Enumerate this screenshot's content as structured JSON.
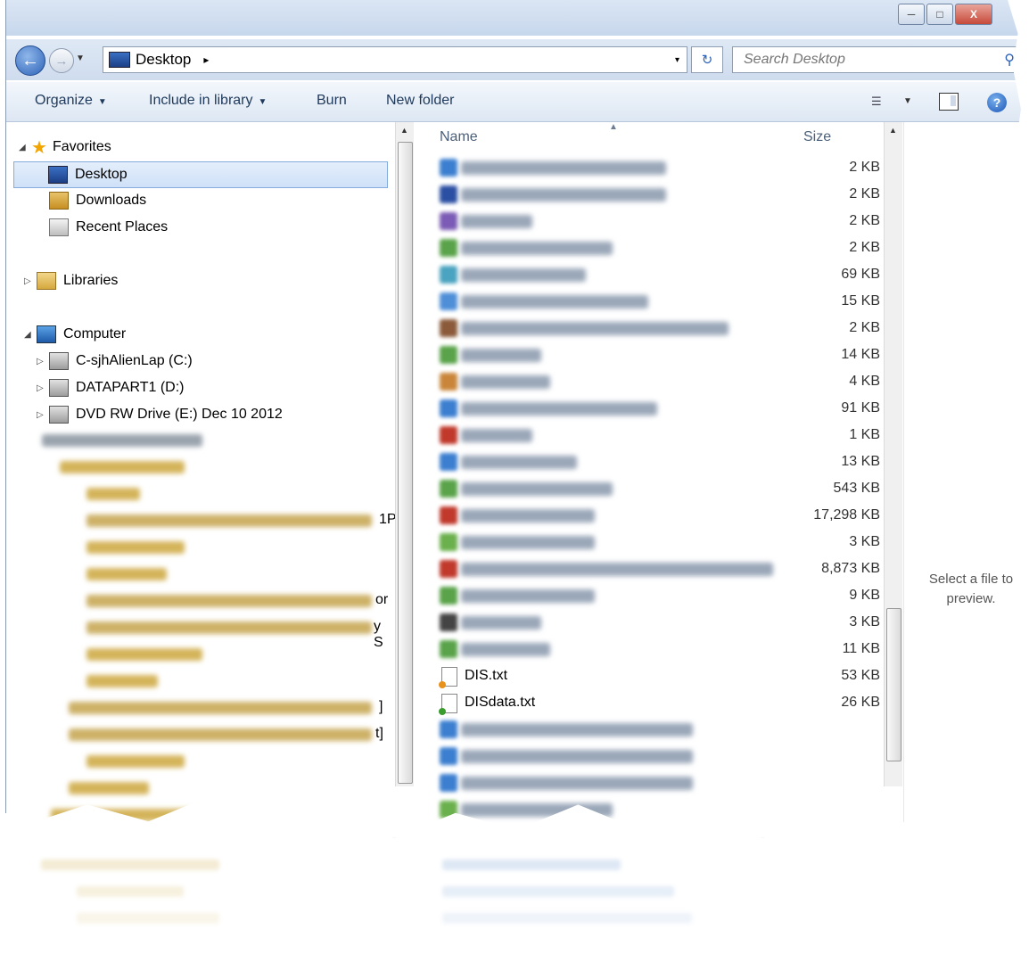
{
  "titlebar": {
    "minimize": "─",
    "maximize": "□",
    "close": "X"
  },
  "address": {
    "location": "Desktop",
    "chevron": "▸",
    "dropdown": "▾",
    "refresh": "↻"
  },
  "search": {
    "placeholder": "Search Desktop",
    "icon": "search-icon"
  },
  "toolbar": {
    "organize": "Organize",
    "include_in_library": "Include in library",
    "burn": "Burn",
    "new_folder": "New folder",
    "dropdown_glyph": "▼"
  },
  "navigation": {
    "favorites": "Favorites",
    "desktop": "Desktop",
    "downloads": "Downloads",
    "recent_places": "Recent Places",
    "libraries": "Libraries",
    "computer": "Computer",
    "drive_c": "C-sjhAlienLap (C:)",
    "drive_d": "DATAPART1 (D:)",
    "drive_e": "DVD RW Drive (E:) Dec 10 2012",
    "partial_text": [
      "1P",
      "or",
      "y S",
      "]",
      "t]"
    ]
  },
  "file_list": {
    "headers": {
      "name": "Name",
      "size": "Size"
    },
    "rows": [
      {
        "name": "",
        "size": "2 KB",
        "icon_color": "#3c7fd0"
      },
      {
        "name": "",
        "size": "2 KB",
        "icon_color": "#2b4fa3"
      },
      {
        "name": "",
        "size": "2 KB",
        "icon_color": "#7b5bb5"
      },
      {
        "name": "",
        "size": "2 KB",
        "icon_color": "#5aa34a"
      },
      {
        "name": "",
        "size": "69 KB",
        "icon_color": "#4aa3c0"
      },
      {
        "name": "",
        "size": "15 KB",
        "icon_color": "#4f8fd8"
      },
      {
        "name": "",
        "size": "2 KB",
        "icon_color": "#8a5a3a"
      },
      {
        "name": "",
        "size": "14 KB",
        "icon_color": "#5aa34a"
      },
      {
        "name": "",
        "size": "4 KB",
        "icon_color": "#c9863a"
      },
      {
        "name": "",
        "size": "91 KB",
        "icon_color": "#3c7fd0"
      },
      {
        "name": "",
        "size": "1 KB",
        "icon_color": "#c0392b"
      },
      {
        "name": "",
        "size": "13 KB",
        "icon_color": "#3c7fd0"
      },
      {
        "name": "",
        "size": "543 KB",
        "icon_color": "#5aa34a"
      },
      {
        "name": "",
        "size": "17,298 KB",
        "icon_color": "#c0392b"
      },
      {
        "name": "",
        "size": "3 KB",
        "icon_color": "#6ab04c"
      },
      {
        "name": "",
        "size": "8,873 KB",
        "icon_color": "#c0392b"
      },
      {
        "name": "",
        "size": "9 KB",
        "icon_color": "#5aa34a"
      },
      {
        "name": "",
        "size": "3 KB",
        "icon_color": "#444444"
      },
      {
        "name": "",
        "size": "11 KB",
        "icon_color": "#5aa34a"
      },
      {
        "name": "DIS.txt",
        "size": "53 KB",
        "icon_color": "#e8921d"
      },
      {
        "name": "DISdata.txt",
        "size": "26 KB",
        "icon_color": "#3a9c2c"
      },
      {
        "name": "",
        "size": "",
        "icon_color": "#3c7fd0"
      },
      {
        "name": "",
        "size": "",
        "icon_color": "#3c7fd0"
      },
      {
        "name": "",
        "size": "",
        "icon_color": "#3c7fd0"
      },
      {
        "name": "",
        "size": "",
        "icon_color": "#6ab04c"
      }
    ]
  },
  "preview": {
    "message": "Select a file to preview."
  }
}
